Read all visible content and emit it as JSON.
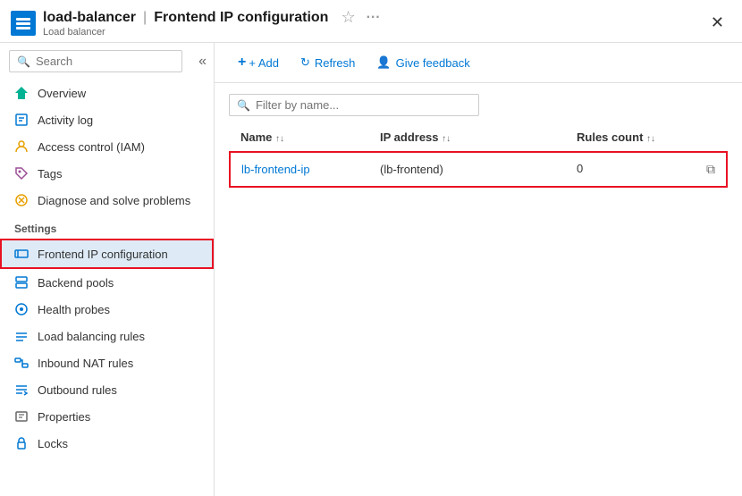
{
  "titleBar": {
    "resourceName": "load-balancer",
    "separator": "|",
    "pageName": "Frontend IP configuration",
    "resourceType": "Load balancer"
  },
  "toolbar": {
    "addLabel": "+ Add",
    "refreshLabel": "Refresh",
    "feedbackLabel": "Give feedback"
  },
  "filter": {
    "placeholder": "Filter by name..."
  },
  "table": {
    "columns": [
      {
        "label": "Name",
        "sort": "↑↓"
      },
      {
        "label": "IP address",
        "sort": "↑↓"
      },
      {
        "label": "Rules count",
        "sort": "↑↓"
      }
    ],
    "rows": [
      {
        "name": "lb-frontend-ip",
        "ipAddress": "(lb-frontend)",
        "rulesCount": "0"
      }
    ]
  },
  "sidebar": {
    "searchPlaceholder": "Search",
    "navItems": [
      {
        "label": "Overview",
        "icon": "overview",
        "section": ""
      },
      {
        "label": "Activity log",
        "icon": "activity",
        "section": ""
      },
      {
        "label": "Access control (IAM)",
        "icon": "iam",
        "section": ""
      },
      {
        "label": "Tags",
        "icon": "tags",
        "section": ""
      },
      {
        "label": "Diagnose and solve problems",
        "icon": "diagnose",
        "section": ""
      },
      {
        "label": "Settings",
        "isSection": true
      },
      {
        "label": "Frontend IP configuration",
        "icon": "frontend",
        "section": "Settings",
        "active": true
      },
      {
        "label": "Backend pools",
        "icon": "backend",
        "section": "Settings"
      },
      {
        "label": "Health probes",
        "icon": "health",
        "section": "Settings"
      },
      {
        "label": "Load balancing rules",
        "icon": "lbrules",
        "section": "Settings"
      },
      {
        "label": "Inbound NAT rules",
        "icon": "natrules",
        "section": "Settings"
      },
      {
        "label": "Outbound rules",
        "icon": "outbound",
        "section": "Settings"
      },
      {
        "label": "Properties",
        "icon": "properties",
        "section": "Settings"
      },
      {
        "label": "Locks",
        "icon": "locks",
        "section": "Settings"
      }
    ]
  }
}
